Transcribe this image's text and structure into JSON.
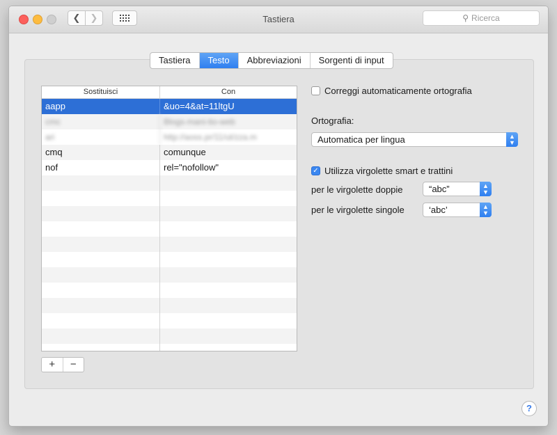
{
  "window": {
    "title": "Tastiera"
  },
  "search": {
    "placeholder": "Ricerca"
  },
  "tabs": [
    {
      "label": "Tastiera",
      "active": false
    },
    {
      "label": "Testo",
      "active": true
    },
    {
      "label": "Abbreviazioni",
      "active": false
    },
    {
      "label": "Sorgenti di input",
      "active": false
    }
  ],
  "table": {
    "headers": [
      "Sostituisci",
      "Con"
    ],
    "rows": [
      {
        "replace": "aapp",
        "with": "&uo=4&at=11ltgU",
        "selected": true
      },
      {
        "replace": "cmc",
        "with": "Blogs-mani-tio-web",
        "blurred": true
      },
      {
        "replace": "ari",
        "with": "http://aoss.pr/11/ut/zza.m",
        "blurred": true
      },
      {
        "replace": "cmq",
        "with": "comunque"
      },
      {
        "replace": "nof",
        "with": "rel=\"nofollow\""
      }
    ]
  },
  "buttons": {
    "add": "+",
    "remove": "−"
  },
  "settings": {
    "autocorrect_label": "Correggi automaticamente ortografia",
    "autocorrect_checked": false,
    "spelling_label": "Ortografia:",
    "spelling_value": "Automatica per lingua",
    "smartquotes_label": "Utilizza virgolette smart e trattini",
    "smartquotes_checked": true,
    "double_quotes_label": "per le virgolette doppie",
    "double_quotes_value": "“abc”",
    "single_quotes_label": "per le virgolette singole",
    "single_quotes_value": "‘abc’"
  },
  "help": {
    "label": "?"
  },
  "colors": {
    "accent": "#2f7ff0",
    "selection": "#2d6fd6"
  }
}
